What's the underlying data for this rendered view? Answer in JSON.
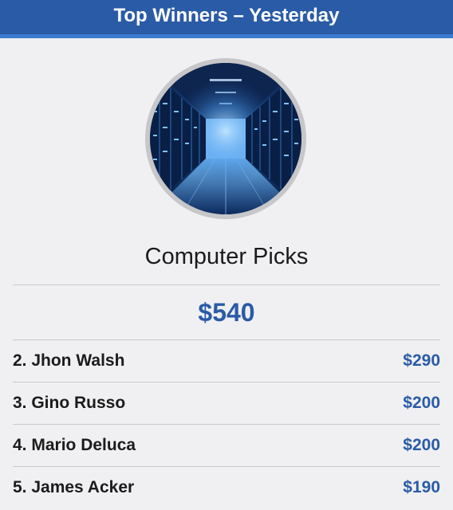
{
  "header": {
    "title": "Top Winners – Yesterday"
  },
  "card": {
    "image_icon": "server-room-image",
    "title": "Computer Picks",
    "amount": "$540"
  },
  "winners": [
    {
      "name": "2. Jhon Walsh",
      "amount": "$290"
    },
    {
      "name": "3. Gino Russo",
      "amount": "$200"
    },
    {
      "name": "4. Mario Deluca",
      "amount": "$200"
    },
    {
      "name": "5. James Acker",
      "amount": "$190"
    }
  ],
  "colors": {
    "header_bg": "#2a5ba6",
    "accent": "#2a5ba6",
    "background": "#f0f0f2"
  }
}
